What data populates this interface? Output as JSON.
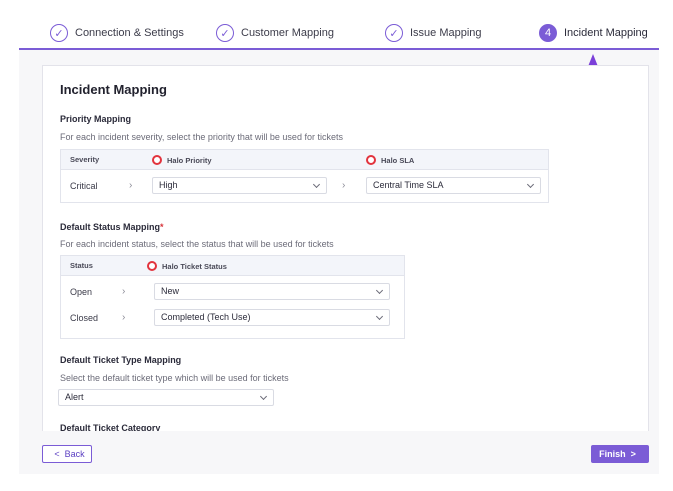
{
  "stepper": {
    "steps": [
      {
        "label": "Connection & Settings",
        "marker": "✓"
      },
      {
        "label": "Customer Mapping",
        "marker": "✓"
      },
      {
        "label": "Issue Mapping",
        "marker": "✓"
      },
      {
        "label": "Incident Mapping",
        "marker": "4"
      }
    ]
  },
  "page": {
    "title": "Incident Mapping"
  },
  "priority": {
    "heading": "Priority Mapping",
    "description": "For each incident severity, select the priority that will be used for tickets",
    "col_severity": "Severity",
    "col_priority": "Halo Priority",
    "col_sla": "Halo SLA",
    "rows": [
      {
        "severity": "Critical",
        "priority": "High",
        "sla": "Central Time SLA"
      }
    ]
  },
  "status": {
    "heading": "Default Status Mapping",
    "required_mark": "*",
    "description": "For each incident status, select the status that will be used for tickets",
    "col_status": "Status",
    "col_ticket_status": "Halo Ticket Status",
    "rows": [
      {
        "status": "Open",
        "ticket_status": "New"
      },
      {
        "status": "Closed",
        "ticket_status": "Completed (Tech Use)"
      }
    ]
  },
  "ticket_type": {
    "heading": "Default Ticket Type Mapping",
    "description": "Select the default ticket type which will be used for tickets",
    "value": "Alert"
  },
  "ticket_category": {
    "heading": "Default Ticket Category"
  },
  "footer": {
    "back_label": "Back",
    "back_chevron": "<",
    "finish_label": "Finish",
    "finish_chevron": ">"
  },
  "colors": {
    "accent": "#7b5cd6",
    "halo_red": "#e2333d",
    "required": "#d8343a"
  },
  "icons": {
    "step_done": "check-circle-icon",
    "step_current": "number-circle-icon",
    "halo": "halo-ring-icon",
    "row_arrow": "chevron-right-icon",
    "select": "chevron-down-icon"
  }
}
